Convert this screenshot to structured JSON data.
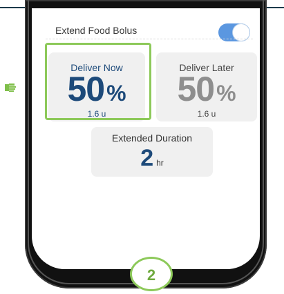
{
  "extend_row": {
    "label": "Extend Food Bolus",
    "toggle_on": true
  },
  "deliver_now": {
    "title": "Deliver Now",
    "percent": "50",
    "percent_sign": "%",
    "units": "1.6 u"
  },
  "deliver_later": {
    "title": "Deliver Later",
    "percent": "50",
    "percent_sign": "%",
    "units": "1.6 u"
  },
  "extended_duration": {
    "title": "Extended Duration",
    "value": "2",
    "unit": "hr"
  },
  "step_badge": {
    "number": "2"
  },
  "colors": {
    "accent_green": "#8dc95a",
    "primary_blue": "#1d4a7a",
    "toggle_blue": "#5b97e0"
  },
  "icons": {
    "pointer": "pointing-hand-icon"
  }
}
